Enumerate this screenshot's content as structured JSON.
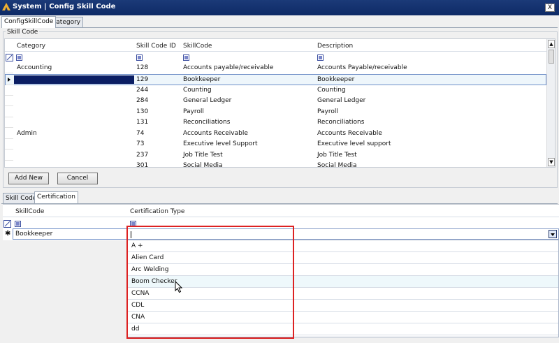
{
  "window": {
    "title": "System | Config Skill Code",
    "close_label": "X"
  },
  "top_tabs": {
    "config": "ConfigSkillCode",
    "category": "Category"
  },
  "skill_group_label": "Skill Code",
  "grid1": {
    "headers": {
      "category": "Category",
      "id": "Skill Code ID",
      "skill": "SkillCode",
      "desc": "Description"
    },
    "rows": [
      {
        "category": "Accounting",
        "id": "128",
        "skill": "Accounts payable/receivable",
        "desc": "Accounts Payable/receivable"
      },
      {
        "category": "",
        "id": "129",
        "skill": "Bookkeeper",
        "desc": "Bookkeeper"
      },
      {
        "category": "",
        "id": "244",
        "skill": "Counting",
        "desc": "Counting"
      },
      {
        "category": "",
        "id": "284",
        "skill": "General Ledger",
        "desc": "General Ledger"
      },
      {
        "category": "",
        "id": "130",
        "skill": "Payroll",
        "desc": "Payroll"
      },
      {
        "category": "",
        "id": "131",
        "skill": "Reconciliations",
        "desc": "Reconciliations"
      },
      {
        "category": "Admin",
        "id": "74",
        "skill": "Accounts Receivable",
        "desc": "Accounts Receivable"
      },
      {
        "category": "",
        "id": "73",
        "skill": "Executive level Support",
        "desc": "Executive level support"
      },
      {
        "category": "",
        "id": "237",
        "skill": "Job Title Test",
        "desc": "Job Title Test"
      },
      {
        "category": "",
        "id": "301",
        "skill": "Social Media",
        "desc": "Social Media"
      }
    ]
  },
  "buttons": {
    "add": "Add New",
    "cancel": "Cancel"
  },
  "bottom_tabs": {
    "skillcode": "Skill Code",
    "cert": "Certification"
  },
  "grid2": {
    "headers": {
      "skill": "SkillCode",
      "cert": "Certification Type"
    },
    "new_row_skill": "Bookkeeper"
  },
  "dropdown": {
    "items": [
      "A +",
      "Alien Card",
      "Arc Welding",
      "Boom Checker",
      "CCNA",
      "CDL",
      "CNA",
      "dd"
    ]
  }
}
